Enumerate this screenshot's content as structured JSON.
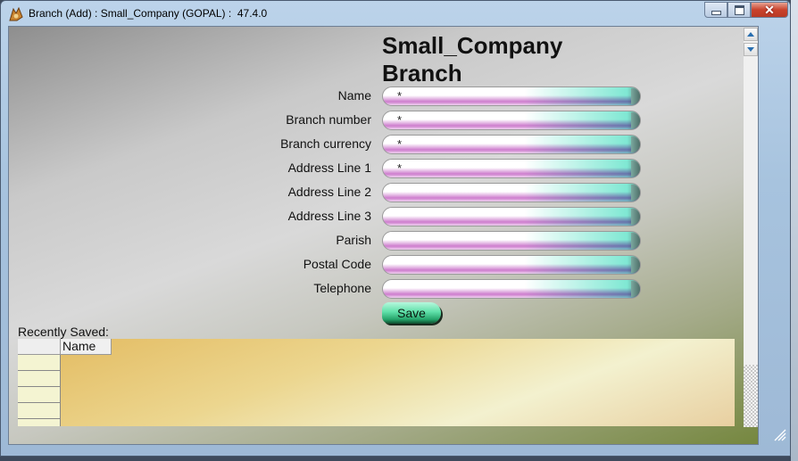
{
  "window": {
    "title": "Branch (Add) : Small_Company (GOPAL) :  47.4.0",
    "icon": "app-logo-icon",
    "controls": {
      "minimize": "minimize-icon",
      "maximize": "maximize-icon",
      "close": "close-icon"
    }
  },
  "form": {
    "heading_line1": "Small_Company",
    "heading_line2": "Branch",
    "fields": [
      {
        "label": "Name",
        "value": "*"
      },
      {
        "label": "Branch number",
        "value": "*"
      },
      {
        "label": "Branch currency",
        "value": "*"
      },
      {
        "label": "Address Line 1",
        "value": "*"
      },
      {
        "label": "Address Line 2",
        "value": ""
      },
      {
        "label": "Address Line 3",
        "value": ""
      },
      {
        "label": "Parish",
        "value": ""
      },
      {
        "label": "Postal Code",
        "value": ""
      },
      {
        "label": "Telephone",
        "value": ""
      }
    ],
    "save_label": "Save"
  },
  "recent": {
    "label": "Recently Saved:",
    "columns": [
      "Name"
    ],
    "rows": [
      "",
      "",
      "",
      "",
      ""
    ]
  },
  "colors": {
    "save_button": "#5fe0a9",
    "field_accent_left": "#c86ec8",
    "field_accent_right": "#7fe8d3",
    "grid_background": "#ecd68f"
  }
}
